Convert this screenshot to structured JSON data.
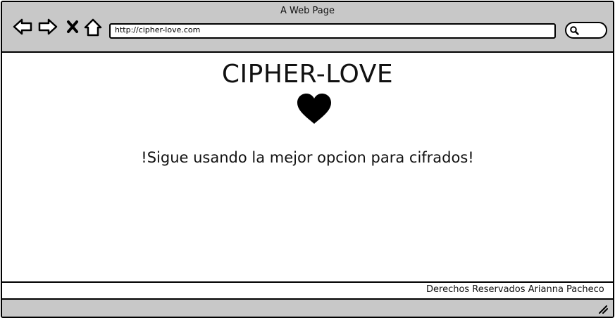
{
  "window": {
    "title": "A Web Page"
  },
  "toolbar": {
    "url": "http://cipher-love.com",
    "icons": [
      "back-arrow-icon",
      "forward-arrow-icon",
      "close-x-icon",
      "home-icon",
      "search-icon"
    ]
  },
  "page": {
    "title": "CIPHER-LOVE",
    "heart_icon": "heart-icon",
    "tagline": "!Sigue usando la mejor opcion para cifrados!"
  },
  "footer": {
    "text": "Derechos Reservados Arianna Pacheco"
  },
  "colors": {
    "chrome": "#c8c8c8",
    "ink": "#000000",
    "content_bg": "#ffffff"
  }
}
